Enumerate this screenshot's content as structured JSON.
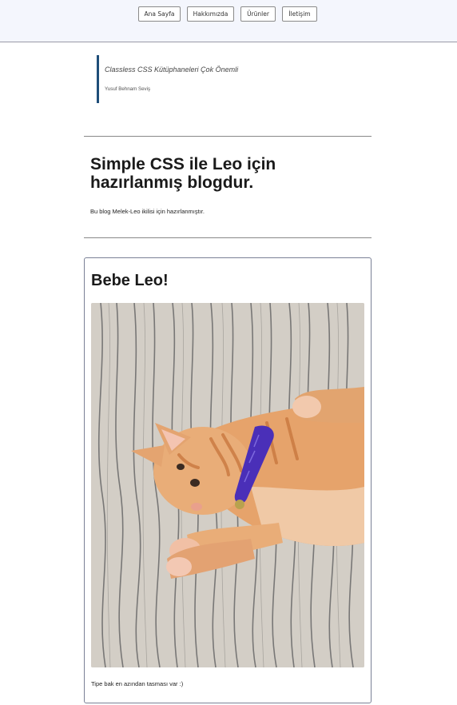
{
  "nav": {
    "items": [
      {
        "label": "Ana Sayfa"
      },
      {
        "label": "Hakkımızda"
      },
      {
        "label": "Ürünler"
      },
      {
        "label": "İletişim"
      }
    ]
  },
  "quote": {
    "text": "Classless CSS Kütüphaneleri Çok Önemli",
    "author": "Yusuf Behnam Seviş"
  },
  "hero": {
    "title": "Simple CSS ile Leo için hazırlanmış blogdur.",
    "intro": "Bu blog Melek-Leo ikilisi için hazırlanmıştır."
  },
  "post": {
    "title": "Bebe Leo!",
    "image": "orange-kitten-purple-collar-photo",
    "caption": "Tipe bak en azından tasması var :)"
  },
  "colors": {
    "topbar": "#f4f6fd",
    "accent": "#1f4e79",
    "collar": "#4a2fb8"
  }
}
